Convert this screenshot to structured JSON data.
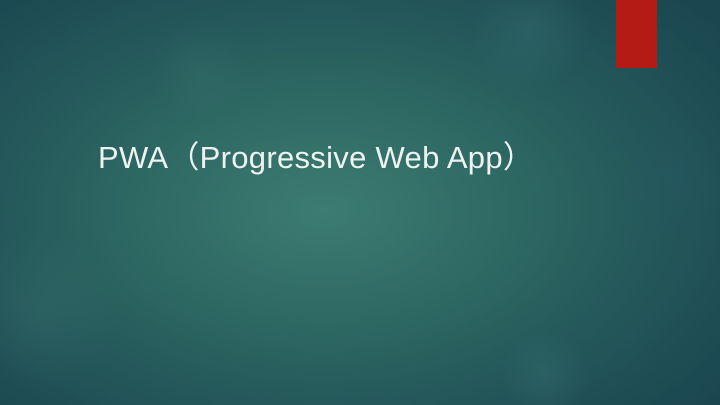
{
  "slide": {
    "title": "PWA（Progressive Web App）"
  },
  "colors": {
    "background_center": "#3d7c72",
    "background_edge": "#1a4650",
    "accent_bar": "#b31b14",
    "title_text": "#eef3f2"
  }
}
